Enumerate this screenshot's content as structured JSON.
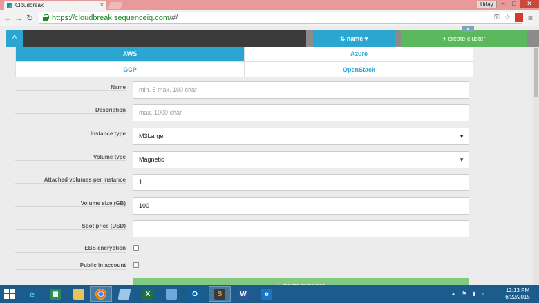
{
  "browser": {
    "tab_title": "Cloudbreak",
    "url_host": "https://cloudbreak.sequenceiq.com",
    "url_path": "/#/",
    "user_name": "Uday",
    "tab_close": "×",
    "win_min": "–",
    "win_max": "□",
    "win_close": "✕"
  },
  "header": {
    "toggle_icon": "^",
    "sort_label": "name ▾",
    "create_cluster_label": "create cluster",
    "create_plus": "+",
    "close_x": "×"
  },
  "cloud_tabs": [
    {
      "label": "AWS",
      "active": true
    },
    {
      "label": "Azure",
      "active": false
    },
    {
      "label": "GCP",
      "active": false
    },
    {
      "label": "OpenStack",
      "active": false
    }
  ],
  "form": {
    "name": {
      "label": "Name",
      "placeholder": "min. 5 max. 100 char",
      "value": ""
    },
    "description": {
      "label": "Description",
      "placeholder": "max. 1000 char",
      "value": ""
    },
    "instance_type": {
      "label": "Instance type",
      "value": "M3Large"
    },
    "volume_type": {
      "label": "Volume type",
      "value": "Magnetic"
    },
    "attached_volumes": {
      "label": "Attached volumes per instance",
      "value": "1"
    },
    "volume_size": {
      "label": "Volume size (GB)",
      "value": "100"
    },
    "spot_price": {
      "label": "Spot price (USD)",
      "value": ""
    },
    "ebs_encryption": {
      "label": "EBS encryption",
      "checked": false
    },
    "public_in_account": {
      "label": "Public in account",
      "checked": false
    },
    "create_template_label": "+ create template"
  },
  "taskbar": {
    "clock_time": "12:13 PM",
    "clock_date": "6/22/2015",
    "icons": [
      "ie-icon",
      "store-icon",
      "explorer-icon",
      "chrome-icon",
      "notepad-icon",
      "excel-icon",
      "remote-icon",
      "outlook-icon",
      "sublime-icon",
      "word-icon",
      "ie-pinned-icon"
    ]
  },
  "colors": {
    "accent": "#2aa6d1",
    "success": "#5cb85c",
    "taskbar": "#1c5c8c",
    "titlebar": "#e89a9a"
  }
}
